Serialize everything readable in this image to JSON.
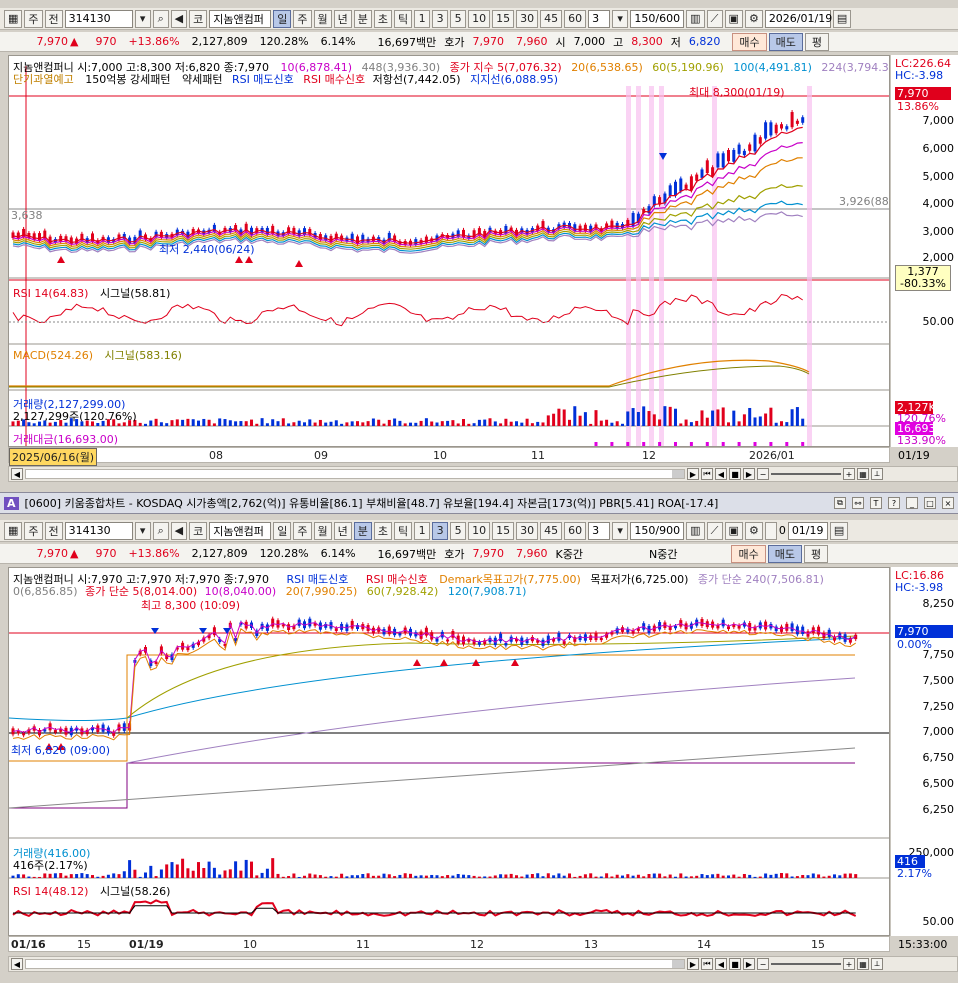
{
  "toolbar_top": {
    "type_label": "주",
    "prev_label": "전",
    "code": "314130",
    "market_label": "코",
    "name": "지놈앤컴퍼",
    "periods": [
      "일",
      "주",
      "월",
      "년"
    ],
    "intraday": [
      "분",
      "초",
      "틱"
    ],
    "intervals": [
      "1",
      "3",
      "5",
      "10",
      "15",
      "30",
      "45",
      "60"
    ],
    "interval_input": "3",
    "count": "150/600",
    "date": "2026/01/19"
  },
  "quote_top": {
    "price": "7,970",
    "arrow": "▲",
    "change": "970",
    "rate": "+13.86%",
    "volume": "2,127,809",
    "vol_rate": "120.28%",
    "turnover": "6.14%",
    "amount": "16,697백만",
    "bid_label": "호가",
    "bid": "7,970",
    "ask": "7,960",
    "open_label": "시",
    "open": "7,000",
    "high_label": "고",
    "high": "8,300",
    "low_label": "저",
    "low": "6,820",
    "buy": "매수",
    "sell": "매도",
    "flat": "평"
  },
  "chart_top": {
    "legend1": {
      "title": "지놈앤컴퍼니 시:7,000 고:8,300 저:6,820 종:7,970",
      "ma10": "10(6,878.41)",
      "ma448": "448(3,936.30)",
      "ema5": "종가 지수 5(7,076.32)",
      "ma20": "20(6,538.65)",
      "ma60": "60(5,190.96)",
      "ma100": "100(4,491.81)",
      "ma224": "224(3,794.36)"
    },
    "legend2": {
      "warn": "단기과열예고",
      "pattern": "150억봉 강세패턴",
      "weak": "약세패턴",
      "rsi_sell": "RSI 매도신호",
      "rsi_buy": "RSI 매수신호",
      "resist": "저항선(7,442.05)",
      "support": "지지선(6,088.95)"
    },
    "lc": "LC:226.64",
    "hc": "HC:-3.98",
    "price_tag": "7,970",
    "rate_tag": "13.86%",
    "ref_price": "3,926(88",
    "left_ref": "3,638",
    "low_tag": "1,377",
    "low_rate": "-80.33%",
    "max_label": "최대 8,300(01/19)",
    "min_label": "최저 2,440(06/24)",
    "y_ticks": [
      "7,000",
      "6,000",
      "5,000",
      "4,000",
      "3,000",
      "2,000"
    ],
    "rsi_label": "RSI 14(64.83)",
    "rsi_signal": "시그널(58.81)",
    "rsi_tick": "50.00",
    "macd_label": "MACD(524.26)",
    "macd_signal": "시그널(583.16)",
    "vol_label": "거래량(2,127,299.00)",
    "vol_sub": "2,127,299주(120.76%)",
    "vol_tag": "2,127K",
    "vol_rate_tag": "120.76%",
    "amt_label": "거래대금(16,693.00)",
    "amt_tag": "16,693",
    "amt_rate_tag": "133.90%",
    "start_date": "2025/06/16(월)",
    "x_labels": [
      "08",
      "09",
      "10",
      "11",
      "12",
      "2026/01"
    ],
    "end_label": "01/19"
  },
  "header_bottom": {
    "badge": "A",
    "text": "[0600] 키움종합차트 - KOSDAQ 시가총액[2,762(억)] 유통비율[86.1] 부채비율[48.7] 유보율[194.4] 자본금[173(억)] PBR[5.41] ROA[-17.4]"
  },
  "toolbar_bottom": {
    "type_label": "주",
    "prev_label": "전",
    "code": "314130",
    "market_label": "코",
    "name": "지놈앤컴퍼",
    "periods": [
      "일",
      "주",
      "월",
      "년"
    ],
    "intraday": [
      "분",
      "초",
      "틱"
    ],
    "intervals": [
      "1",
      "3",
      "5",
      "10",
      "15",
      "30",
      "45",
      "60"
    ],
    "interval_input": "3",
    "count": "150/900",
    "zero": "0",
    "date": "01/19"
  },
  "quote_bottom": {
    "price": "7,970",
    "arrow": "▲",
    "change": "970",
    "rate": "+13.86%",
    "volume": "2,127,809",
    "vol_rate": "120.28%",
    "turnover": "6.14%",
    "amount": "16,697백만",
    "bid_label": "호가",
    "bid": "7,970",
    "ask": "7,960",
    "k_label": "K중간",
    "n_label": "N중간",
    "buy": "매수",
    "sell": "매도",
    "flat": "평"
  },
  "chart_bottom": {
    "legend1": {
      "title": "지놈앤컴퍼니 시:7,970 고:7,970 저:7,970 종:7,970",
      "rsi_sell": "RSI 매도신호",
      "rsi_buy": "RSI 매수신호",
      "demark_hi": "Demark목표고가(7,775.00)",
      "demark_lo": "목표저가(6,725.00)",
      "sma240": "종가 단순 240(7,506.81)"
    },
    "legend2": {
      "ma0": "0(6,856.85)",
      "sma5": "종가 단순 5(8,014.00)",
      "ma10": "10(8,040.00)",
      "ma20": "20(7,990.25)",
      "ma60": "60(7,928.42)",
      "ma120": "120(7,908.71)"
    },
    "lc": "LC:16.86",
    "hc": "HC:-3.98",
    "price_tag": "7,970",
    "rate_tag": "0.00%",
    "max_label": "최고 8,300 (10:09)",
    "min_label": "최저 6,820 (09:00)",
    "y_ticks": [
      "8,250",
      "8,000",
      "7,750",
      "7,500",
      "7,250",
      "7,000",
      "6,750",
      "6,500",
      "6,250"
    ],
    "vol_label": "거래량(416.00)",
    "vol_sub": "416주(2.17%)",
    "vol_tick": "250,000",
    "vol_tag": "416",
    "vol_rate_tag": "2.17%",
    "rsi_label": "RSI 14(48.12)",
    "rsi_signal": "시그널(58.26)",
    "rsi_tick": "50.00",
    "x_labels": [
      "01/16",
      "15",
      "01/19",
      "10",
      "11",
      "12",
      "13",
      "14",
      "15"
    ],
    "end_label": "15:33:00"
  }
}
